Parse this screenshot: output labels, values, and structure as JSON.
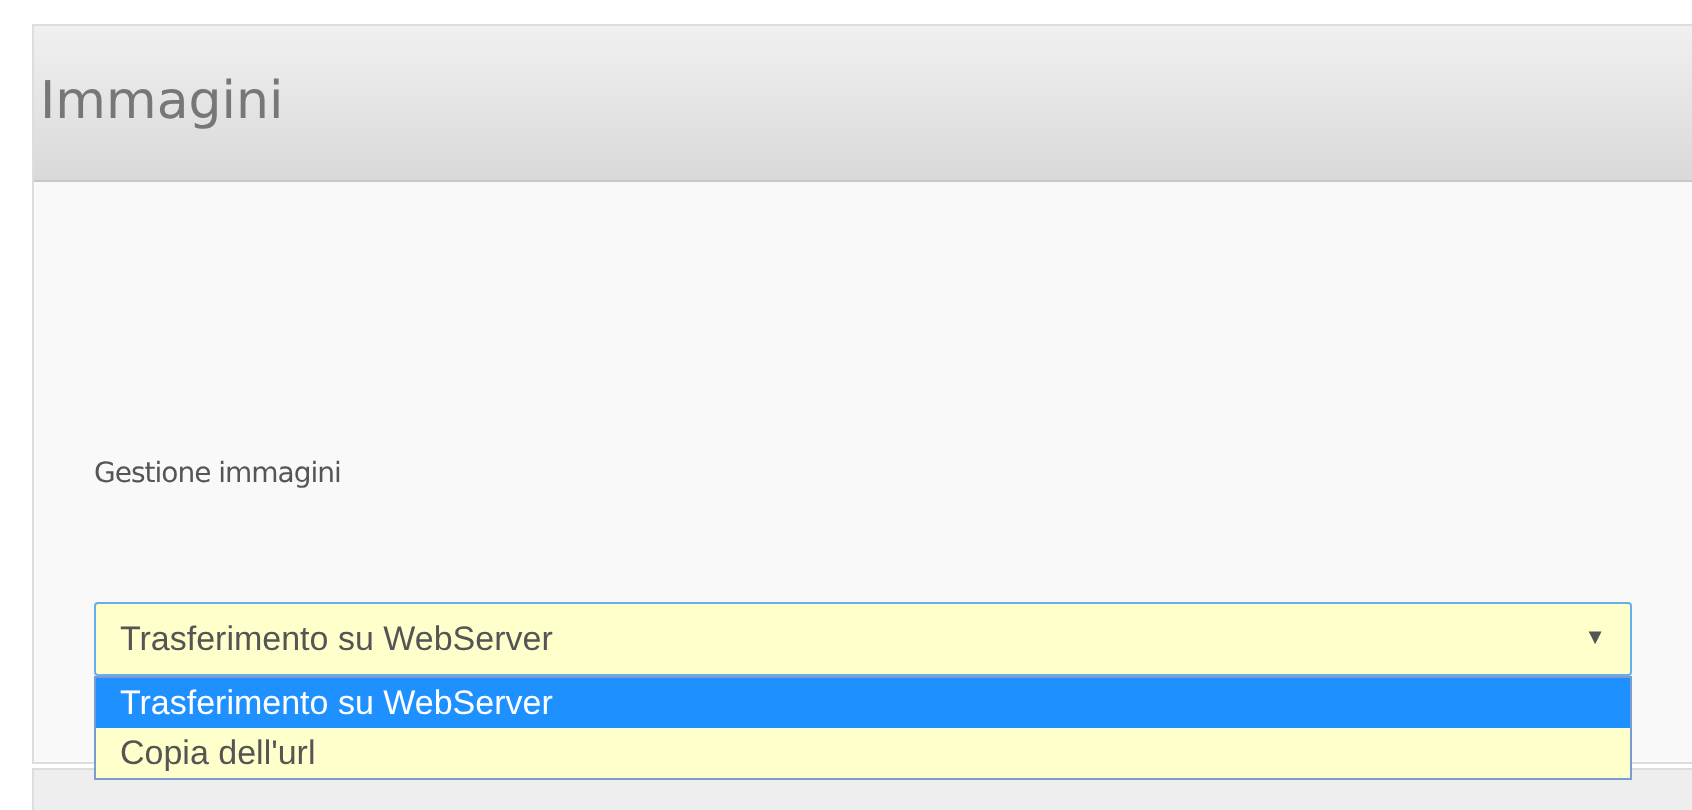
{
  "panel": {
    "title": "Immagini"
  },
  "field": {
    "label": "Gestione immagini",
    "value": "Trasferimento su WebServer",
    "arrow": "▼",
    "expanded": true,
    "options": [
      {
        "label": "Trasferimento su WebServer",
        "selected": true
      },
      {
        "label": "Copia dell'url",
        "selected": false
      }
    ]
  }
}
